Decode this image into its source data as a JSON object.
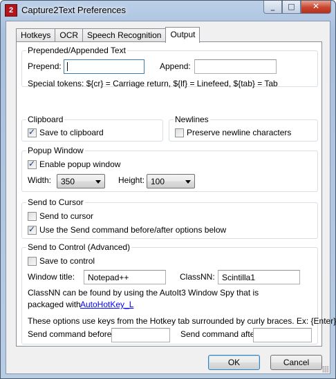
{
  "window": {
    "title": "Capture2Text Preferences",
    "app_icon_letter": "2",
    "minimize_glyph": "_",
    "maximize_glyph": "□",
    "close_glyph": "✕"
  },
  "tabs": [
    {
      "label": "Hotkeys"
    },
    {
      "label": "OCR"
    },
    {
      "label": "Speech Recognition"
    },
    {
      "label": "Output",
      "active": true
    }
  ],
  "prepend_append": {
    "title": "Prepended/Appended Text",
    "prepend_label": "Prepend:",
    "prepend_value": "",
    "append_label": "Append:",
    "append_value": "",
    "special_tokens": "Special tokens:  ${cr} = Carriage return,  ${lf} = Linefeed,  ${tab} = Tab"
  },
  "clipboard": {
    "title": "Clipboard",
    "save_label": "Save to clipboard",
    "save_checked": true
  },
  "newlines": {
    "title": "Newlines",
    "preserve_label": "Preserve newline characters",
    "preserve_checked": false
  },
  "popup": {
    "title": "Popup Window",
    "enable_label": "Enable popup window",
    "enable_checked": true,
    "width_label": "Width:",
    "width_value": "350",
    "height_label": "Height:",
    "height_value": "100"
  },
  "send_cursor": {
    "title": "Send to Cursor",
    "send_label": "Send to cursor",
    "send_checked": false,
    "use_send_label": "Use the Send command before/after options below",
    "use_send_checked": true
  },
  "send_control": {
    "title": "Send to Control (Advanced)",
    "save_label": "Save to control",
    "save_checked": false,
    "window_title_label": "Window title:",
    "window_title_value": "Notepad++",
    "classnn_label": "ClassNN:",
    "classnn_value": "Scintilla1",
    "info_line1": "ClassNN can be found by using the AutoIt3 Window Spy that is",
    "info_line2_prefix": "packaged with",
    "autohotkey_link": "AutoHotKey_L",
    "hotkey_info": "These options use keys from the Hotkey tab surrounded by curly braces. Ex: {Enter}",
    "before_label": "Send command before:",
    "before_value": "",
    "after_label": "Send command after:",
    "after_value": ""
  },
  "buttons": {
    "ok": "OK",
    "cancel": "Cancel"
  }
}
